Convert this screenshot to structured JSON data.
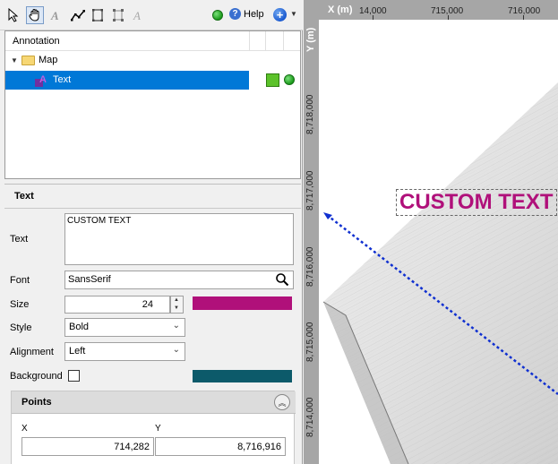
{
  "toolbar": {
    "tools": [
      {
        "name": "select-arrow-icon"
      },
      {
        "name": "pan-hand-icon",
        "active": true
      },
      {
        "name": "text-tool-icon"
      },
      {
        "name": "polyline-icon"
      },
      {
        "name": "rectangle-icon"
      },
      {
        "name": "resize-icon"
      },
      {
        "name": "text-style-icon"
      }
    ],
    "help_label": "Help"
  },
  "tree": {
    "header": "Annotation",
    "items": [
      {
        "label": "Map",
        "icon": "folder-icon"
      },
      {
        "label": "Text",
        "icon": "text-layer-icon",
        "selected": true
      }
    ]
  },
  "properties": {
    "title": "Text",
    "text_label": "Text",
    "text_value": "CUSTOM TEXT",
    "font_label": "Font",
    "font_value": "SansSerif",
    "size_label": "Size",
    "size_value": "24",
    "text_color": "#b0107a",
    "style_label": "Style",
    "style_value": "Bold",
    "alignment_label": "Alignment",
    "alignment_value": "Left",
    "background_label": "Background",
    "background_checked": false,
    "background_color": "#0c5a6a"
  },
  "points": {
    "title": "Points",
    "col_x": "X",
    "col_y": "Y",
    "rows": [
      {
        "x": "714,282",
        "y": "8,716,916"
      }
    ]
  },
  "map": {
    "x_axis_label": "X (m)",
    "y_axis_label": "Y (m)",
    "x_ticks": [
      "14,000",
      "715,000",
      "716,000"
    ],
    "y_ticks": [
      "8,718,000",
      "8,717,000",
      "8,716,000",
      "8,715,000",
      "8,714,000"
    ],
    "annotation_text": "CUSTOM TEXT",
    "annotation_color": "#b0107a",
    "line_color": "#1030d0"
  }
}
